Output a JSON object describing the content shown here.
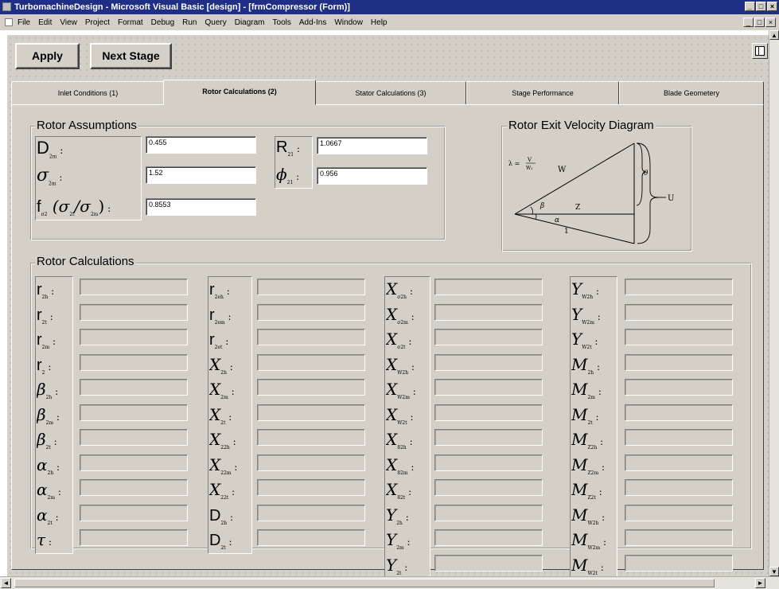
{
  "window": {
    "title": "TurbomachineDesign - Microsoft Visual Basic [design] - [frmCompressor (Form)]"
  },
  "menu": [
    "File",
    "Edit",
    "View",
    "Project",
    "Format",
    "Debug",
    "Run",
    "Query",
    "Diagram",
    "Tools",
    "Add-Ins",
    "Window",
    "Help"
  ],
  "toolbar": {
    "apply_label": "Apply",
    "next_stage_label": "Next Stage"
  },
  "tabs": [
    {
      "label": "Inlet Conditions (1)",
      "active": false
    },
    {
      "label": "Rotor Calculations (2)",
      "active": true
    },
    {
      "label": "Stator Calculations (3)",
      "active": false
    },
    {
      "label": "Stage Performance",
      "active": false
    },
    {
      "label": "Blade Geometery",
      "active": false
    }
  ],
  "rotor_assumptions": {
    "title": "Rotor Assumptions",
    "fields": [
      {
        "symbol": "D",
        "sub": "2m",
        "value": "0.455"
      },
      {
        "symbol": "σ",
        "sub": "2m",
        "value": "1.52"
      },
      {
        "symbol": "f",
        "sub": "σ2",
        "extra": "(σ",
        "extra_sub": "2t",
        "extra2": "/σ",
        "extra2_sub": "2m",
        "extra3": ")",
        "value": "0.8553"
      },
      {
        "symbol": "R",
        "sub": "21",
        "value": "1.0667"
      },
      {
        "symbol": "ϕ",
        "sub": "21",
        "value": "0.956"
      }
    ]
  },
  "velocity_diagram": {
    "title": "Rotor Exit Velocity Diagram",
    "labels": {
      "lambda_eq": "λ = ",
      "num": "V",
      "den": "W₂",
      "w": "W",
      "beta": "β",
      "z": "Z",
      "alpha": "α",
      "one": "1",
      "theta": "θ",
      "u": "U"
    }
  },
  "rotor_calculations": {
    "title": "Rotor Calculations",
    "columns": [
      [
        {
          "symbol": "r",
          "sub": "2h",
          "roman": true
        },
        {
          "symbol": "r",
          "sub": "2t",
          "roman": true
        },
        {
          "symbol": "r",
          "sub": "2m",
          "roman": true
        },
        {
          "symbol": "r",
          "sub": "2",
          "roman": true
        },
        {
          "symbol": "β",
          "sub": "2h"
        },
        {
          "symbol": "β",
          "sub": "2m"
        },
        {
          "symbol": "β",
          "sub": "2t"
        },
        {
          "symbol": "α",
          "sub": "2h"
        },
        {
          "symbol": "α",
          "sub": "2m"
        },
        {
          "symbol": "α",
          "sub": "2t"
        },
        {
          "symbol": "τ",
          "sub": ""
        }
      ],
      [
        {
          "symbol": "r",
          "sub": "2eh",
          "roman": true
        },
        {
          "symbol": "r",
          "sub": "2em",
          "roman": true
        },
        {
          "symbol": "r",
          "sub": "2et",
          "roman": true
        },
        {
          "symbol": "X",
          "sub": "2h"
        },
        {
          "symbol": "X",
          "sub": "2m"
        },
        {
          "symbol": "X",
          "sub": "2t"
        },
        {
          "symbol": "X",
          "sub": "22h"
        },
        {
          "symbol": "X",
          "sub": "22m"
        },
        {
          "symbol": "X",
          "sub": "22t"
        },
        {
          "symbol": "D",
          "sub": "2h",
          "roman": true
        },
        {
          "symbol": "D",
          "sub": "2t",
          "roman": true
        }
      ],
      [
        {
          "symbol": "X",
          "sub": "σ2h"
        },
        {
          "symbol": "X",
          "sub": "σ2m"
        },
        {
          "symbol": "X",
          "sub": "σ2t"
        },
        {
          "symbol": "X",
          "sub": "W2h"
        },
        {
          "symbol": "X",
          "sub": "W2m"
        },
        {
          "symbol": "X",
          "sub": "W2t"
        },
        {
          "symbol": "X",
          "sub": "82h"
        },
        {
          "symbol": "X",
          "sub": "82m"
        },
        {
          "symbol": "X",
          "sub": "82t"
        },
        {
          "symbol": "Y",
          "sub": "2h"
        },
        {
          "symbol": "Y",
          "sub": "2m"
        },
        {
          "symbol": "Y",
          "sub": "2t"
        }
      ],
      [
        {
          "symbol": "Y",
          "sub": "W2h"
        },
        {
          "symbol": "Y",
          "sub": "W2m"
        },
        {
          "symbol": "Y",
          "sub": "W2t"
        },
        {
          "symbol": "M",
          "sub": "2h"
        },
        {
          "symbol": "M",
          "sub": "2m"
        },
        {
          "symbol": "M",
          "sub": "2t"
        },
        {
          "symbol": "M",
          "sub": "Z2h"
        },
        {
          "symbol": "M",
          "sub": "Z2m"
        },
        {
          "symbol": "M",
          "sub": "Z2t"
        },
        {
          "symbol": "M",
          "sub": "W2h"
        },
        {
          "symbol": "M",
          "sub": "W2m"
        },
        {
          "symbol": "M",
          "sub": "W2t"
        }
      ]
    ]
  }
}
